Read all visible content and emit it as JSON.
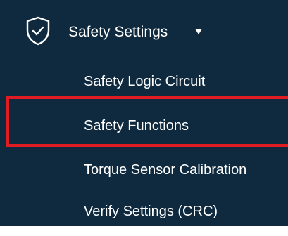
{
  "menu": {
    "header": {
      "icon": "shield-check-icon",
      "label": "Safety Settings",
      "caret_icon": "caret-down-icon",
      "expanded": true
    },
    "items": [
      {
        "label": "Safety Logic Circuit"
      },
      {
        "label": "Safety Functions",
        "highlighted": true
      },
      {
        "label": "Torque Sensor Calibration"
      },
      {
        "label": "Verify Settings (CRC)"
      }
    ]
  },
  "colors": {
    "panel_background": "#0f2a3f",
    "text": "#ffffff",
    "highlight_border": "#e01b22"
  }
}
